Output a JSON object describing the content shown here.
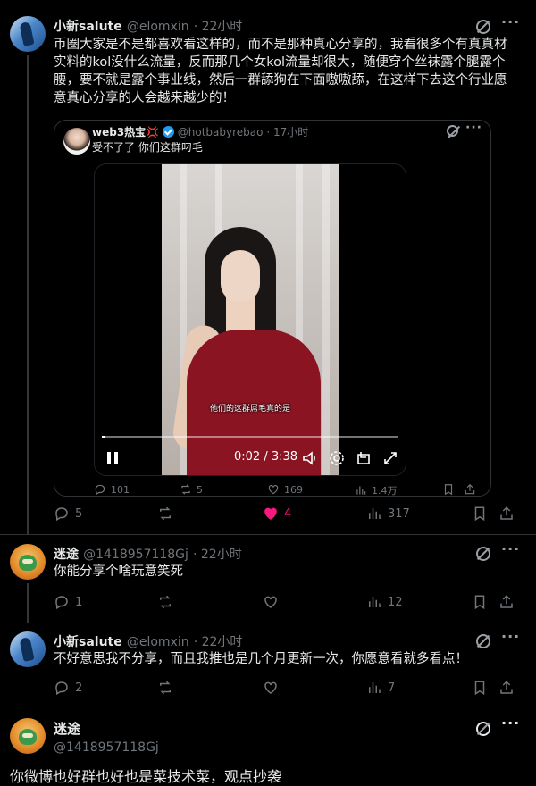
{
  "post1": {
    "name": "小新salute",
    "handle": "@elomxin",
    "time": "· 22小时",
    "text": "币圈大家是不是都喜欢看这样的，而不是那种真心分享的，我看很多个有真真材实料的kol没什么流量，反而那几个女kol流量却很大，随便穿个丝袜露个腿露个腰，要不就是露个事业线，然后一群舔狗在下面嗷嗷舔，在这样下去这个行业愿意真心分享的人会越来越少的！",
    "quote": {
      "name": "web3热宝💢",
      "handle": "@hotbabyrebao",
      "time": "· 17小时",
      "text": "受不了了 你们这群叼毛",
      "video": {
        "subtitle": "他们的这群屌毛真的是",
        "time": "0:02 / 3:38",
        "progress": 0.01
      },
      "actions": {
        "reply": "101",
        "repost": "5",
        "like": "169",
        "views": "1.4万"
      }
    },
    "actions": {
      "reply": "5",
      "repost": "",
      "like": "4",
      "views": "317"
    },
    "like_color": "#f91880"
  },
  "reply1": {
    "name": "迷途",
    "handle": "@1418957118Gj",
    "time": "· 22小时",
    "text": "你能分享个啥玩意笑死",
    "actions": {
      "reply": "1",
      "repost": "",
      "like": "",
      "views": "12"
    }
  },
  "reply2": {
    "name": "小新salute",
    "handle": "@elomxin",
    "time": "· 22小时",
    "text": "不好意思我不分享，而且我推也是几个月更新一次，你愿意看就多看点！",
    "actions": {
      "reply": "2",
      "repost": "",
      "like": "",
      "views": "7"
    }
  },
  "reply3": {
    "name": "迷途",
    "handle": "@1418957118Gj",
    "text": "你微博也好群也好也是菜技术菜，观点抄袭"
  },
  "colors": {
    "background": "#000000",
    "text": "#e7e9ea",
    "muted": "#71767b",
    "accent": "#1d9bf0",
    "like": "#f91880"
  },
  "icons": [
    "grok-icon",
    "more-icon",
    "reply-icon",
    "repost-icon",
    "heart-icon",
    "views-icon",
    "bookmark-icon",
    "share-icon",
    "pause-icon",
    "volume-icon",
    "settings-icon",
    "pip-icon",
    "fullscreen-icon",
    "verified-icon"
  ]
}
